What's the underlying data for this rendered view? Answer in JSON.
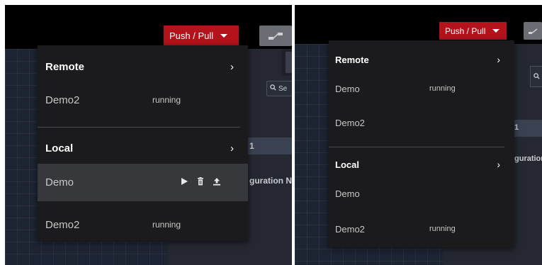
{
  "left": {
    "push_pull_label": "Push / Pull",
    "search_partial": "Se",
    "row_number": "1",
    "config_text": "guration N",
    "remote": {
      "title": "Remote",
      "items": [
        {
          "name": "Demo2",
          "status": "running"
        }
      ]
    },
    "local": {
      "title": "Local",
      "items": [
        {
          "name": "Demo",
          "status": ""
        },
        {
          "name": "Demo2",
          "status": "running"
        }
      ]
    }
  },
  "right": {
    "push_pull_label": "Push / Pull",
    "row_number": "1",
    "config_text": "guration",
    "remote": {
      "title": "Remote",
      "items": [
        {
          "name": "Demo",
          "status": "running"
        },
        {
          "name": "Demo2",
          "status": ""
        }
      ]
    },
    "local": {
      "title": "Local",
      "items": [
        {
          "name": "Demo",
          "status": ""
        },
        {
          "name": "Demo2",
          "status": "running"
        }
      ]
    }
  },
  "icons": {
    "chevron": "chevron-right-icon",
    "play": "play-icon",
    "delete": "trash-icon",
    "upload": "upload-icon",
    "search": "search-icon",
    "dropdown": "caret-down-icon",
    "flow": "flow-icon"
  },
  "colors": {
    "accent_red": "#b5131c",
    "menu_bg": "#1b1b1d",
    "highlight_row": "#37383b",
    "workspace": "#1d2433"
  }
}
